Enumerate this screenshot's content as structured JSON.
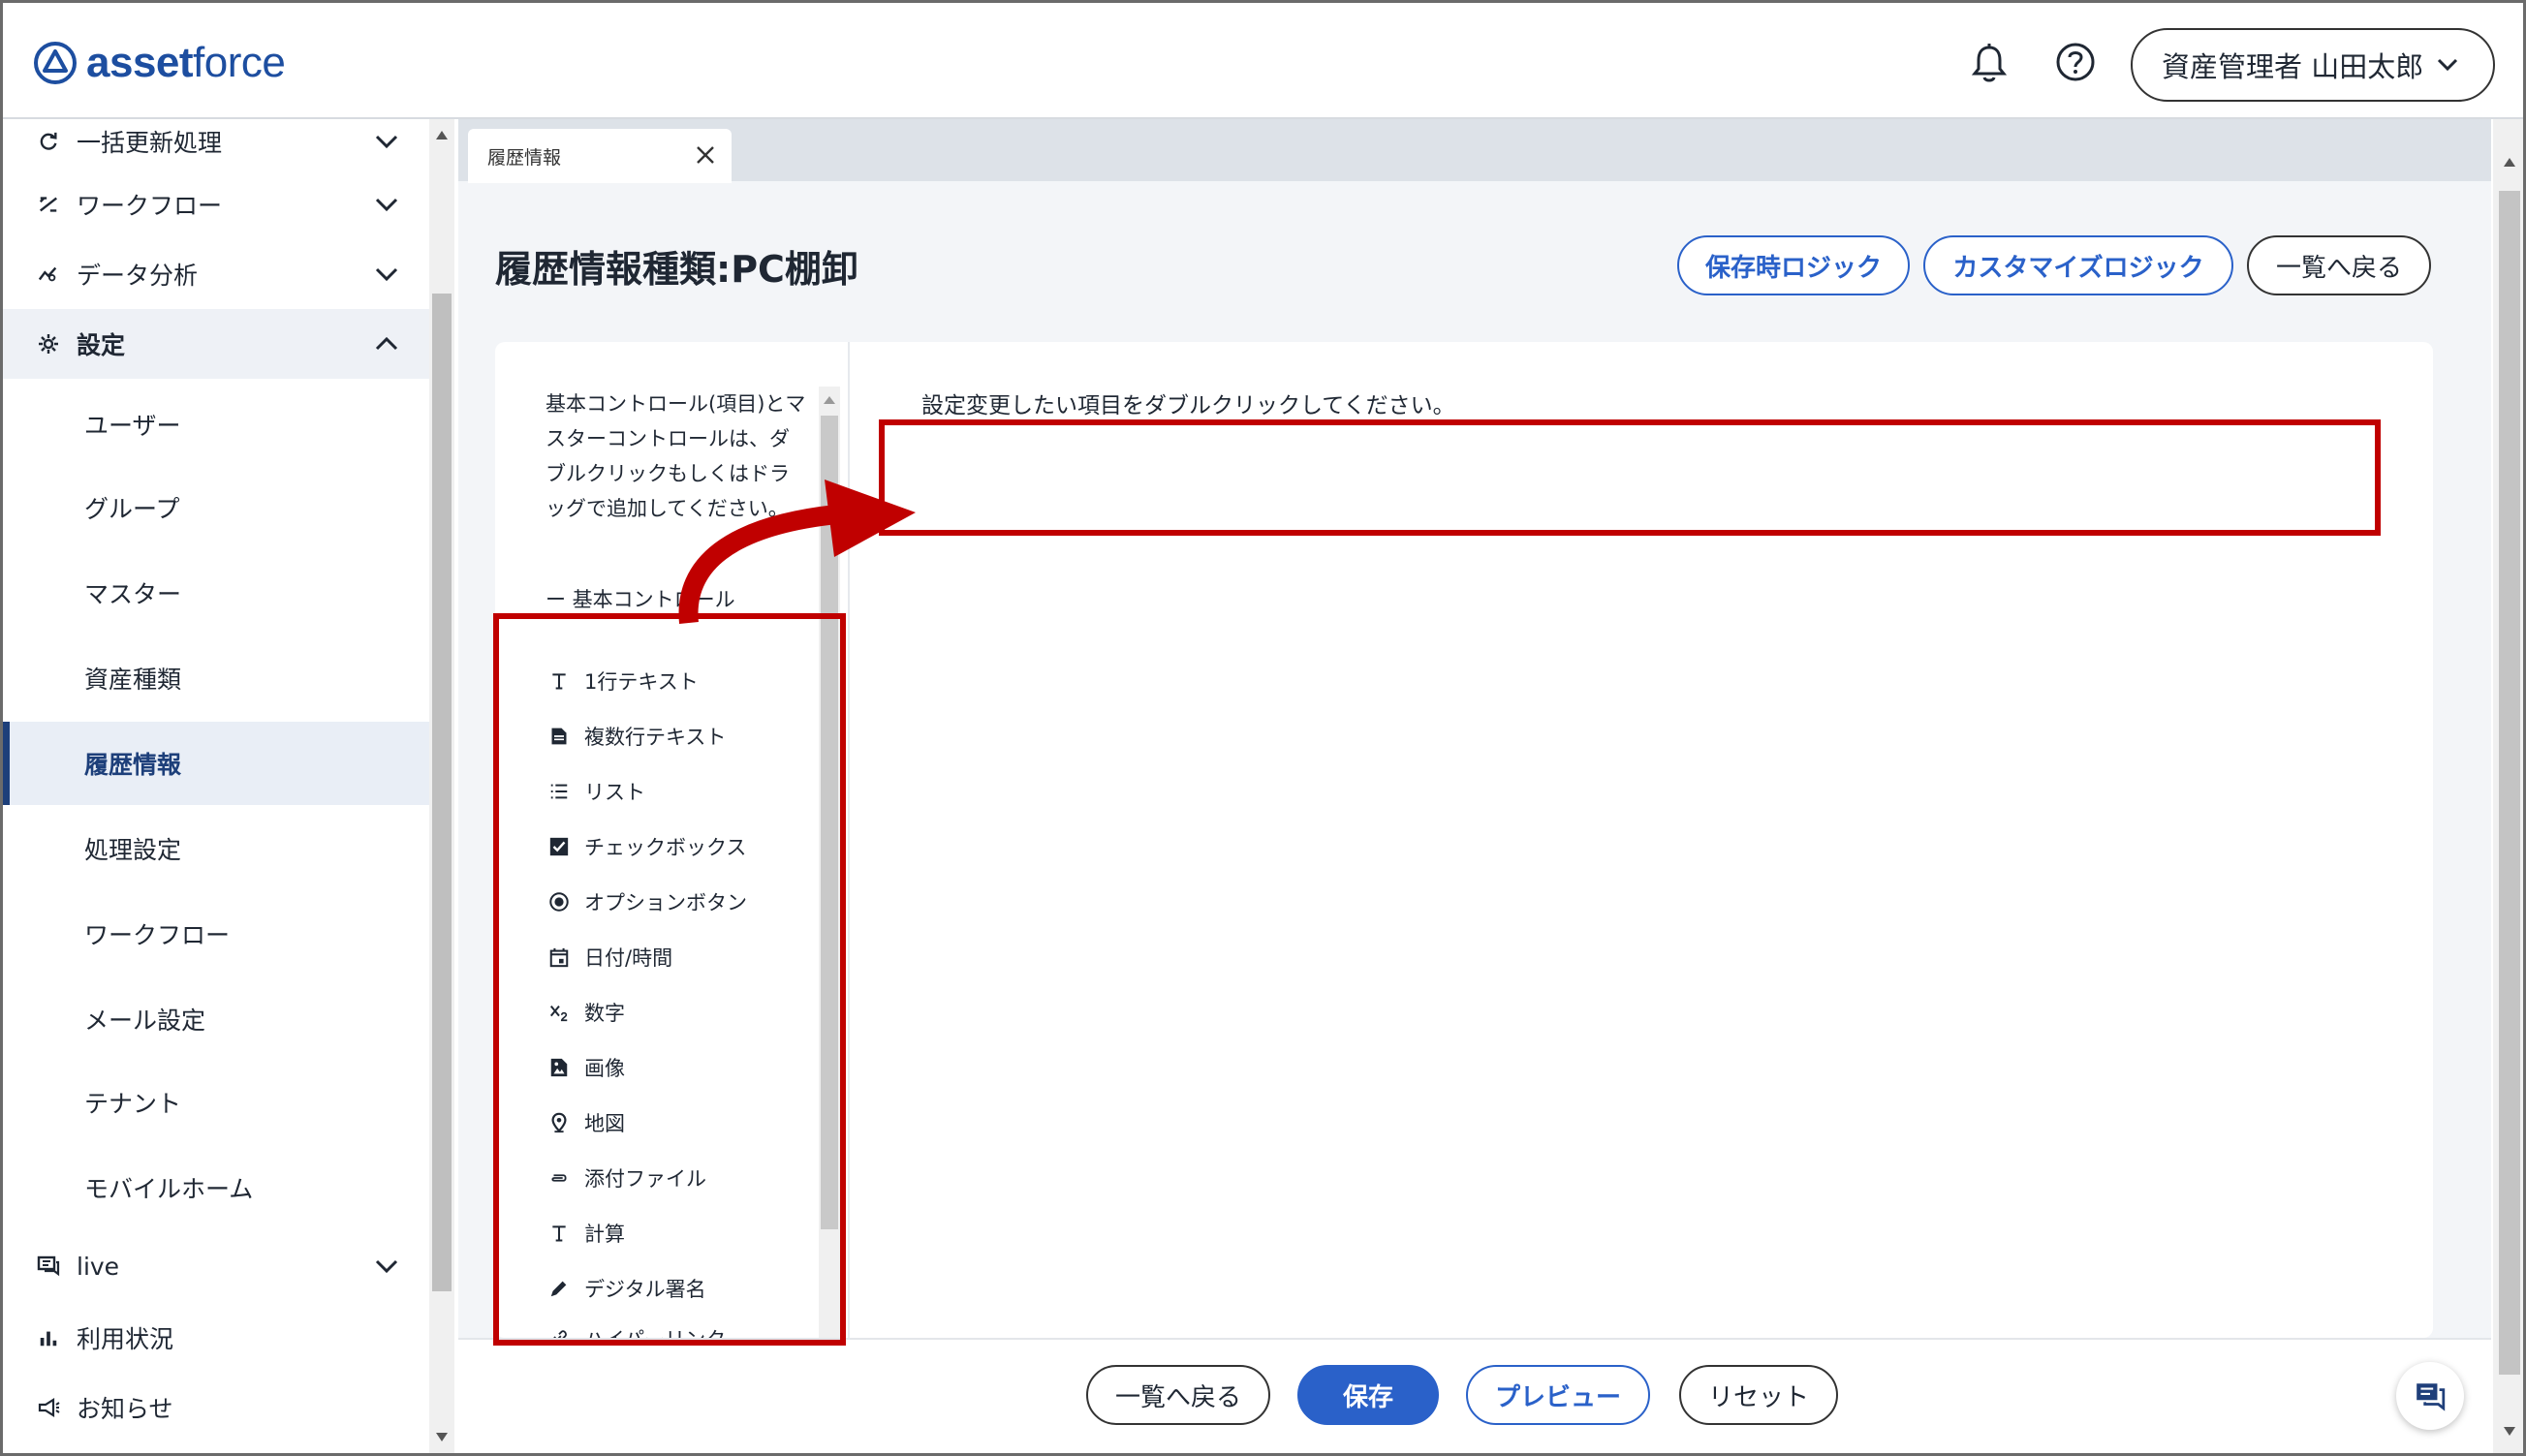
{
  "header": {
    "logo": {
      "part1": "asset",
      "part2": "force"
    },
    "user_menu_label": "資産管理者 山田太郎"
  },
  "sidebar": {
    "items": [
      {
        "label": "一括更新処理",
        "icon": "refresh-icon",
        "expandable": true
      },
      {
        "label": "ワークフロー",
        "icon": "workflow-icon",
        "expandable": true
      },
      {
        "label": "データ分析",
        "icon": "analytics-icon",
        "expandable": true
      },
      {
        "label": "設定",
        "icon": "gear-icon",
        "expandable": true,
        "expanded": true
      }
    ],
    "sub_items": [
      {
        "label": "ユーザー"
      },
      {
        "label": "グループ"
      },
      {
        "label": "マスター"
      },
      {
        "label": "資産種類"
      },
      {
        "label": "履歴情報",
        "selected": true
      },
      {
        "label": "処理設定"
      },
      {
        "label": "ワークフロー"
      },
      {
        "label": "メール設定"
      },
      {
        "label": "テナント"
      },
      {
        "label": "モバイルホーム"
      }
    ],
    "bottom_items": [
      {
        "label": "live",
        "icon": "chat-icon",
        "expandable": true
      },
      {
        "label": "利用状況",
        "icon": "bar-chart-icon"
      },
      {
        "label": "お知らせ",
        "icon": "megaphone-icon"
      }
    ]
  },
  "tabs": [
    {
      "label": "履歴情報"
    }
  ],
  "page": {
    "title": "履歴情報種類:PC棚卸",
    "buttons": {
      "save_logic": "保存時ロジック",
      "custom_logic": "カスタマイズロジック",
      "back_to_list": "一覧へ戻る"
    }
  },
  "controls": {
    "description": "基本コントロール(項目)とマスターコントロールは、ダブルクリックもしくはドラッグで追加してください。",
    "heading": "ー 基本コントロール",
    "items": [
      {
        "label": "1行テキスト",
        "icon": "text-icon"
      },
      {
        "label": "複数行テキスト",
        "icon": "multiline-text-icon"
      },
      {
        "label": "リスト",
        "icon": "list-icon"
      },
      {
        "label": "チェックボックス",
        "icon": "checkbox-icon"
      },
      {
        "label": "オプションボタン",
        "icon": "radio-icon"
      },
      {
        "label": "日付/時間",
        "icon": "calendar-icon"
      },
      {
        "label": "数字",
        "icon": "number-icon"
      },
      {
        "label": "画像",
        "icon": "image-icon"
      },
      {
        "label": "地図",
        "icon": "map-pin-icon"
      },
      {
        "label": "添付ファイル",
        "icon": "attachment-icon"
      },
      {
        "label": "計算",
        "icon": "calculation-icon"
      },
      {
        "label": "デジタル署名",
        "icon": "pen-icon"
      },
      {
        "label": "ハイパーリンク",
        "icon": "link-icon"
      }
    ]
  },
  "editor": {
    "instruction": "設定変更したい項目をダブルクリックしてください。"
  },
  "footer": {
    "back_to_list": "一覧へ戻る",
    "save": "保存",
    "preview": "プレビュー",
    "reset": "リセット"
  },
  "colors": {
    "brand": "#1d4ea0",
    "accent": "#2a61c9",
    "annotation": "#c00000",
    "selected_bg": "#e9eef6"
  }
}
